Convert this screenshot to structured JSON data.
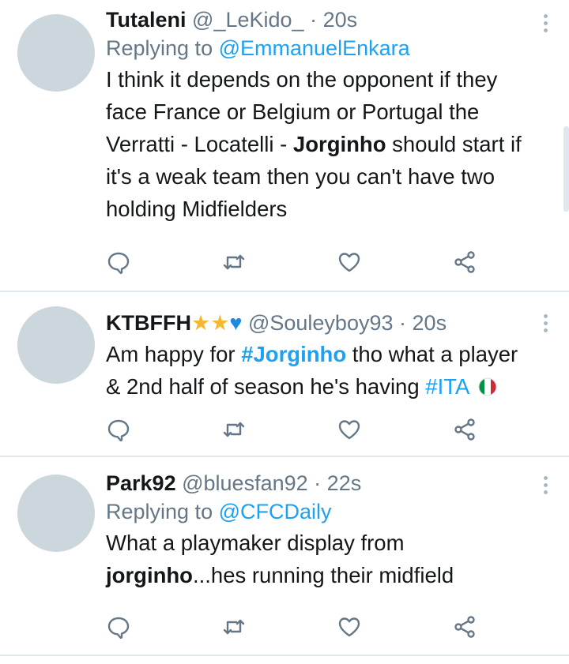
{
  "tweets": [
    {
      "name": "Tutaleni",
      "handle": "@_LeKido_",
      "dot": "·",
      "time": "20s",
      "replying_label": "Replying to",
      "replying_to": "@EmmanuelEnkara",
      "body_lines": [
        "I think it depends on the opponent if they",
        "face France or Belgium or Portugal the",
        "Verratti - Locatelli - ",
        "Jorginho",
        " should start if",
        "it's a weak team then you can't have two",
        "holding Midfielders"
      ]
    },
    {
      "name": "KTBFFH",
      "name_emojis": [
        "★",
        "★",
        "♥"
      ],
      "handle": "@Souleyboy93",
      "dot": "·",
      "time": "20s",
      "body_parts": {
        "p1": "Am happy for ",
        "tag1": "#Jorginho",
        "p2": " tho what a player",
        "line2": "& 2nd half of season he's having ",
        "tag2": "#ITA"
      }
    },
    {
      "name": "Park92",
      "handle": "@bluesfan92",
      "dot": "·",
      "time": "22s",
      "replying_label": "Replying to",
      "replying_to": "@CFCDaily",
      "body_parts": {
        "line1": "What a playmaker display from",
        "bold": "jorginho",
        "rest": "...hes running their midfield"
      }
    }
  ],
  "icons": [
    "reply-icon",
    "retweet-icon",
    "like-icon",
    "share-icon",
    "more-icon"
  ],
  "colors": {
    "link": "#1da1f2",
    "muted": "#657786",
    "divider": "#e1e8ed",
    "avatar": "#ccd6dd"
  }
}
